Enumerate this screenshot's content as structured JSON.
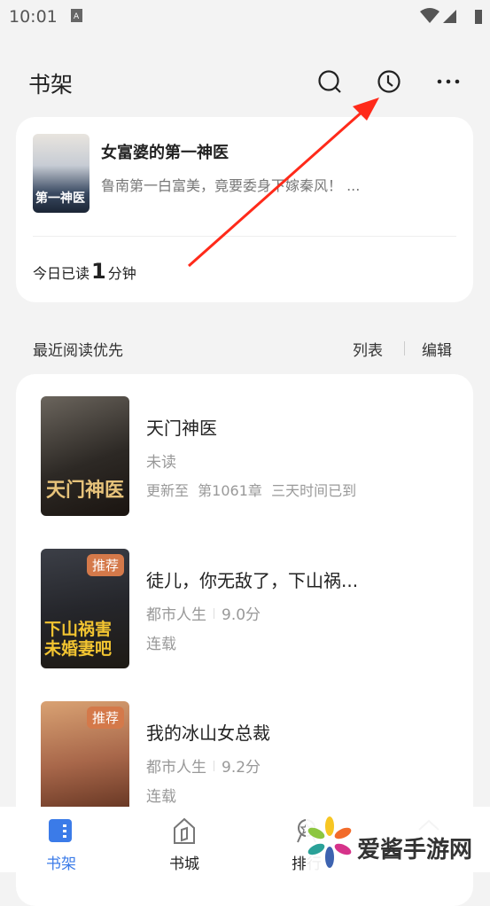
{
  "status": {
    "time": "10:01"
  },
  "header": {
    "title": "书架",
    "icons": [
      "search-icon",
      "history-clock-icon",
      "more-icon"
    ]
  },
  "recent": {
    "title": "女富婆的第一神医",
    "desc": "鲁南第一白富美，竟要委身下嫁秦风！ ...",
    "read_prefix": "今日已读",
    "read_minutes": "1",
    "read_suffix": "分钟"
  },
  "section": {
    "sort_label": "最近阅读优先",
    "list_label": "列表",
    "edit_label": "编辑"
  },
  "books": [
    {
      "title": "天门神医",
      "line2": "未读",
      "line3": "更新至  第1061章  三天时间已到",
      "badge": ""
    },
    {
      "title": "徒儿，你无敌了，下山祸...",
      "genre": "都市人生",
      "score": "9.0分",
      "line3": "连载",
      "badge": "推荐"
    },
    {
      "title": "我的冰山女总裁",
      "genre": "都市人生",
      "score": "9.2分",
      "line3": "连载",
      "badge": "推荐"
    }
  ],
  "nav": {
    "items": [
      {
        "label": "书架",
        "active": true
      },
      {
        "label": "书城"
      },
      {
        "label": "排行"
      },
      {
        "label": ""
      }
    ]
  },
  "watermark": "爱酱手游网",
  "colors": {
    "accent": "#3b7be8",
    "annotation_arrow": "#ff2a1a",
    "badge": "#d4794a"
  }
}
